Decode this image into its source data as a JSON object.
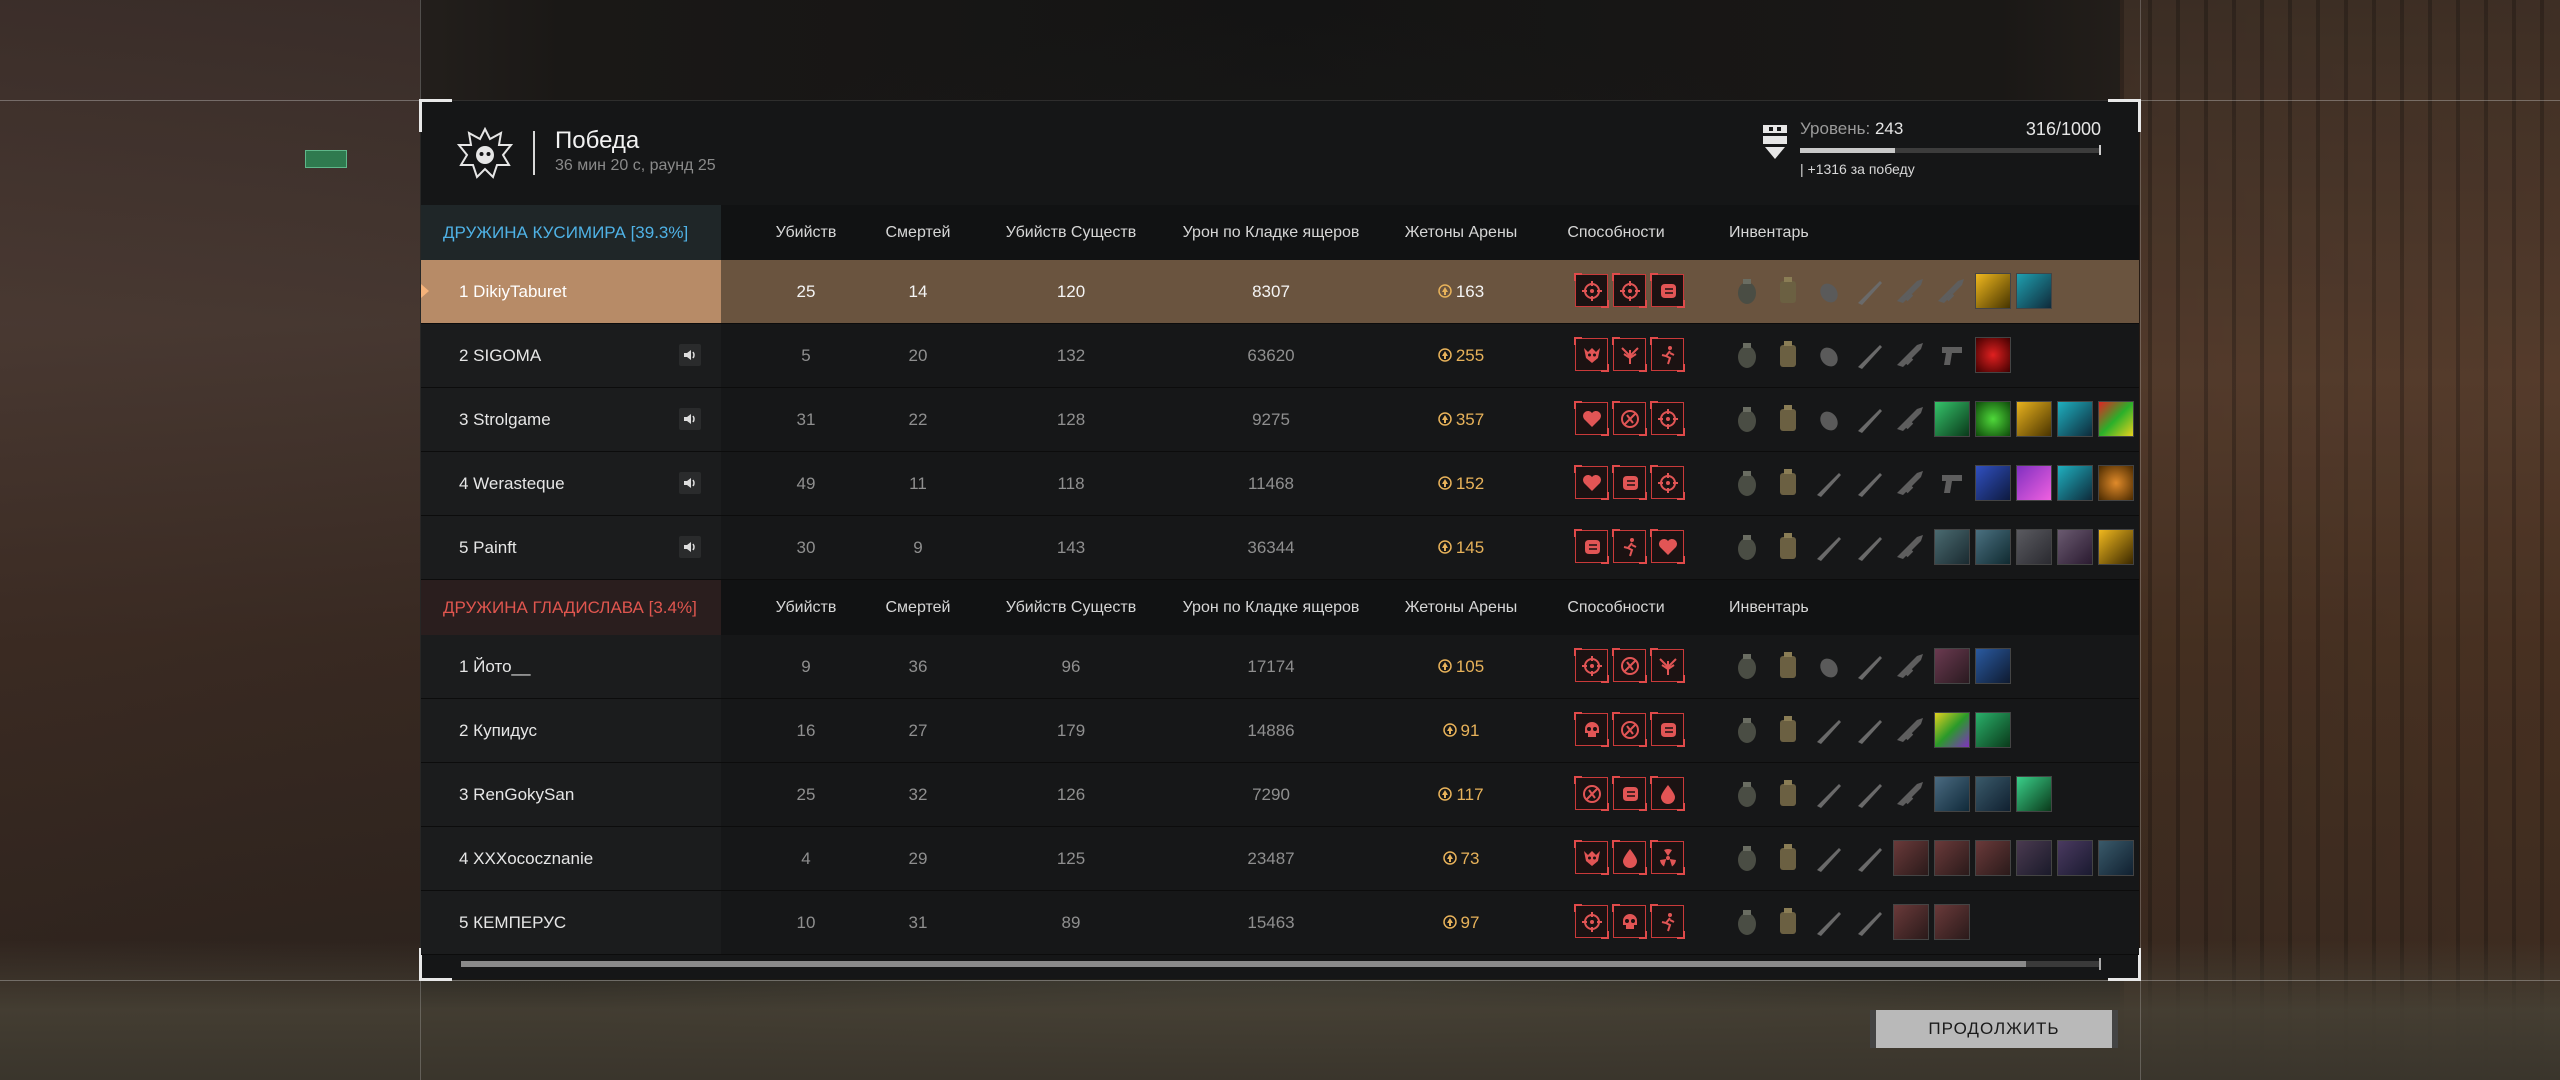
{
  "header": {
    "title": "Победа",
    "subtitle": "36 мин 20 с, раунд 25",
    "level_label": "Уровень:",
    "level_value": "243",
    "xp": "316/1000",
    "xp_fraction": 0.316,
    "bonus": "| +1316 за победу"
  },
  "columns": {
    "kills": "Убийств",
    "deaths": "Смертей",
    "creature_kills": "Убийств Существ",
    "lizard_damage": "Урон по Кладке ящеров",
    "arena_tokens": "Жетоны Арены",
    "abilities": "Способности",
    "inventory": "Инвентарь"
  },
  "teams": [
    {
      "name": "ДРУЖИНА КУСИМИРА [39.3%]",
      "color": "#4fb2e6",
      "players": [
        {
          "name": "1 DikiyTaburet",
          "kills": "25",
          "deaths": "14",
          "creatures": "120",
          "damage": "8307",
          "tokens": "163",
          "highlight": true
        },
        {
          "name": "2 SIGOMA",
          "kills": "5",
          "deaths": "20",
          "creatures": "132",
          "damage": "63620",
          "tokens": "255"
        },
        {
          "name": "3 Strolgame",
          "kills": "31",
          "deaths": "22",
          "creatures": "128",
          "damage": "9275",
          "tokens": "357"
        },
        {
          "name": "4 Werasteque",
          "kills": "49",
          "deaths": "11",
          "creatures": "118",
          "damage": "11468",
          "tokens": "152"
        },
        {
          "name": "5 Painft",
          "kills": "30",
          "deaths": "9",
          "creatures": "143",
          "damage": "36344",
          "tokens": "145"
        }
      ]
    },
    {
      "name": "ДРУЖИНА ГЛАДИСЛАВА [3.4%]",
      "color": "#e0564f",
      "players": [
        {
          "name": "1 Йото__",
          "kills": "9",
          "deaths": "36",
          "creatures": "96",
          "damage": "17174",
          "tokens": "105"
        },
        {
          "name": "2 Купидус",
          "kills": "16",
          "deaths": "27",
          "creatures": "179",
          "damage": "14886",
          "tokens": "91"
        },
        {
          "name": "3 RenGokySan",
          "kills": "25",
          "deaths": "32",
          "creatures": "126",
          "damage": "7290",
          "tokens": "117"
        },
        {
          "name": "4 XXXococznanie",
          "kills": "4",
          "deaths": "29",
          "creatures": "125",
          "damage": "23487",
          "tokens": "73"
        },
        {
          "name": "5 КЕМПЕРУС",
          "kills": "10",
          "deaths": "31",
          "creatures": "89",
          "damage": "15463",
          "tokens": "97"
        }
      ]
    }
  ],
  "continue_label": "ПРОДОЛЖИТЬ"
}
